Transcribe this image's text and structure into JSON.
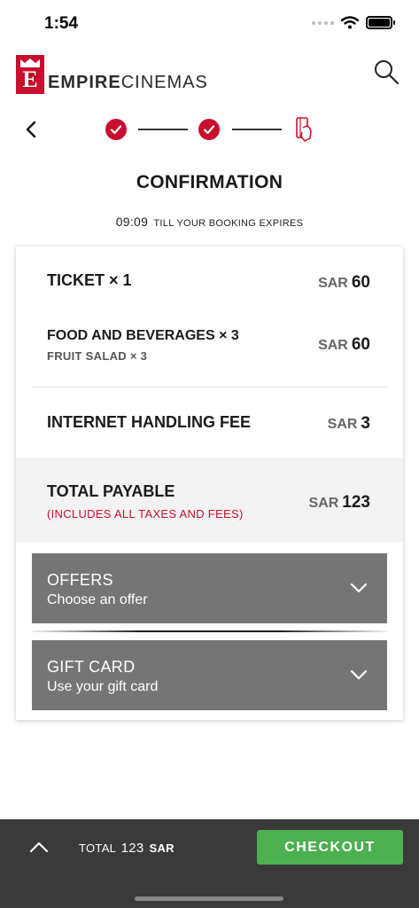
{
  "status_bar": {
    "time": "1:54"
  },
  "header": {
    "logo_letter": "E",
    "brand_bold": "EMPIRE",
    "brand_light": "CINEMAS"
  },
  "page": {
    "title": "CONFIRMATION",
    "timer": "09:09",
    "expiry_text": "TILL YOUR BOOKING EXPIRES"
  },
  "summary": {
    "items": [
      {
        "label": "TICKET × 1",
        "currency": "SAR",
        "amount": "60"
      },
      {
        "label": "FOOD AND BEVERAGES × 3",
        "sublabel": "FRUIT SALAD × 3",
        "currency": "SAR",
        "amount": "60"
      },
      {
        "label": "INTERNET HANDLING FEE",
        "currency": "SAR",
        "amount": "3"
      }
    ],
    "total": {
      "label": "TOTAL PAYABLE",
      "note": "(INCLUDES ALL TAXES AND FEES)",
      "currency": "SAR",
      "amount": "123"
    }
  },
  "accordions": [
    {
      "title": "OFFERS",
      "subtitle": "Choose an offer"
    },
    {
      "title": "GIFT CARD",
      "subtitle": "Use your gift card"
    }
  ],
  "footer": {
    "total_label": "TOTAL",
    "total_amount": "123",
    "total_currency": "SAR",
    "checkout_label": "CHECKOUT"
  },
  "colors": {
    "brand_red": "#c8102e",
    "checkout_green": "#4caf50",
    "accordion_grey": "#757575",
    "footer_dark": "#3a3a3a"
  },
  "icons": [
    "wifi-icon",
    "battery-icon",
    "crown-icon",
    "search-icon",
    "back-arrow-icon",
    "checkmark-icon",
    "payment-card-icon",
    "chevron-down-icon",
    "chevron-up-icon"
  ]
}
